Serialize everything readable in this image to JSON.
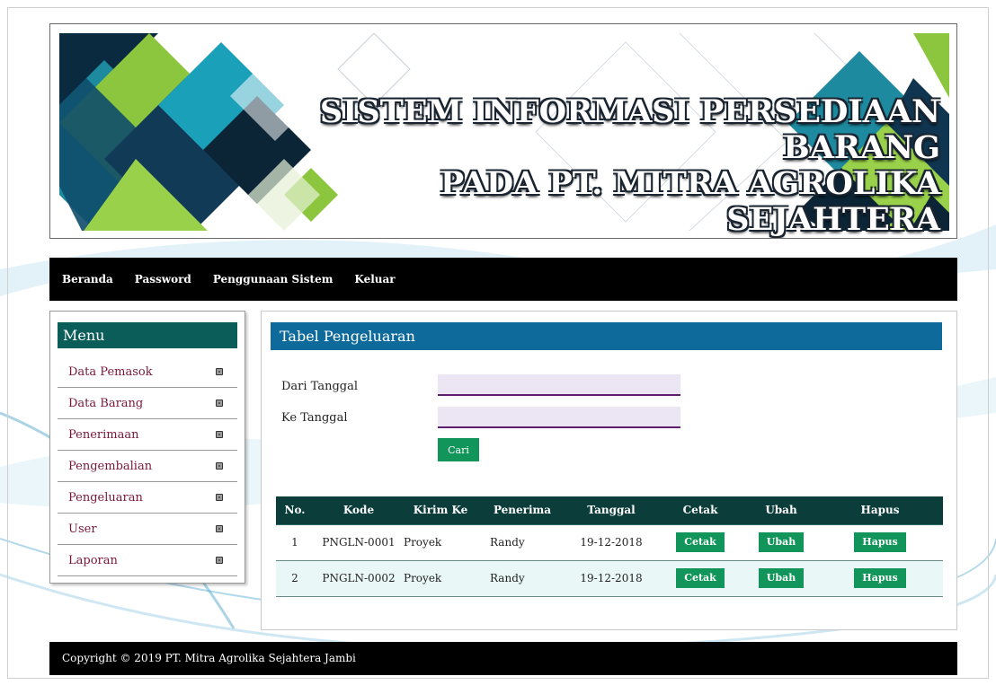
{
  "banner": {
    "title_line1": "SISTEM INFORMASI PERSEDIAAN BARANG",
    "title_line2": "PADA PT. MITRA AGROLIKA SEJAHTERA"
  },
  "nav": {
    "items": [
      "Beranda",
      "Password",
      "Penggunaan Sistem",
      "Keluar"
    ]
  },
  "sidebar": {
    "title": "Menu",
    "items": [
      "Data Pemasok",
      "Data Barang",
      "Penerimaan",
      "Pengembalian",
      "Pengeluaran",
      "User",
      "Laporan"
    ]
  },
  "main": {
    "title": "Tabel Pengeluaran",
    "from_label": "Dari Tanggal",
    "from_value": "",
    "to_label": "Ke Tanggal",
    "to_value": "",
    "search_label": "Cari"
  },
  "table": {
    "headers": [
      "No.",
      "Kode",
      "Kirim Ke",
      "Penerima",
      "Tanggal",
      "Cetak",
      "Ubah",
      "Hapus"
    ],
    "rows": [
      {
        "no": "1",
        "kode": "PNGLN-0001",
        "kirim_ke": "Proyek",
        "penerima": "Randy",
        "tanggal": "19-12-2018",
        "cetak": "Cetak",
        "ubah": "Ubah",
        "hapus": "Hapus"
      },
      {
        "no": "2",
        "kode": "PNGLN-0002",
        "kirim_ke": "Proyek",
        "penerima": "Randy",
        "tanggal": "19-12-2018",
        "cetak": "Cetak",
        "ubah": "Ubah",
        "hapus": "Hapus"
      }
    ]
  },
  "footer": {
    "text": "Copyright © 2019 PT. Mitra Agrolika Sejahtera Jambi"
  },
  "colors": {
    "nav_bg": "#000000",
    "sidebar_head": "#0b5d5a",
    "content_head": "#0d6a9b",
    "table_head": "#0b3d3a",
    "button_green": "#12955a",
    "menu_text": "#7a1738"
  }
}
